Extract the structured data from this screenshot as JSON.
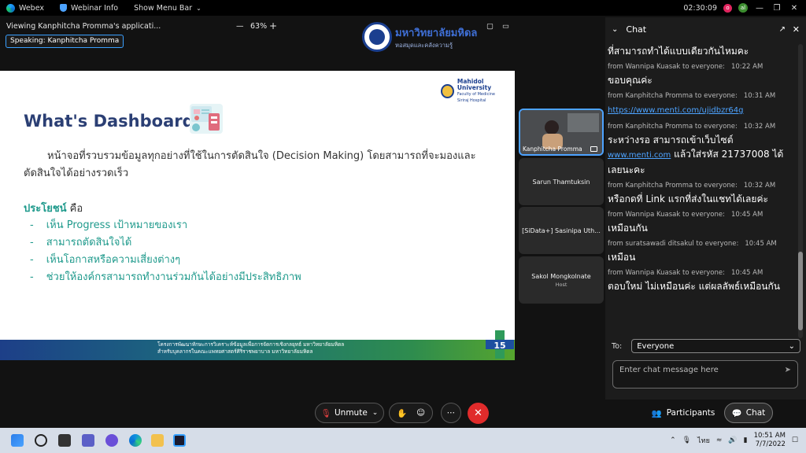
{
  "titlebar": {
    "app": "Webex",
    "webinar_info": "Webinar Info",
    "show_menu": "Show Menu Bar",
    "timer": "02:30:09",
    "badge_o": "o",
    "badge_g": "al"
  },
  "viewbar": {
    "viewing": "Viewing Kanphitcha Promma's applicati...",
    "zoom": "63%",
    "speaking": "Speaking: Kanphitcha Promma"
  },
  "header_logo": {
    "name": "มหาวิทยาลัยมหิดล",
    "sub": "หอสมุดและคลังความรู้"
  },
  "slide": {
    "logo_name": "Mahidol University",
    "logo_sub1": "Faculty of Medicine",
    "logo_sub2": "Siriraj Hospital",
    "title": "What's Dashboard?",
    "body": "หน้าจอที่รวบรวมข้อมูลทุกอย่างที่ใช้ในการตัดสินใจ (Decision Making) โดยสามารถที่จะมองและตัดสินใจได้อย่างรวดเร็ว",
    "benefit_label": "ประโยชน์",
    "benefit_rest": " คือ",
    "bullets": [
      "เห็น Progress เป้าหมายของเรา",
      "สามารถตัดสินใจได้",
      "เห็นโอกาสหรือความเสี่ยงต่างๆ",
      "ช่วยให้องค์กรสามารถทำงานร่วมกันได้อย่างมีประสิทธิภาพ"
    ],
    "footer_line1": "โครงการพัฒนาทักษะการวิเคราะห์ข้อมูลเพื่อการจัดการเชิงกลยุทธ์ มหาวิทยาลัยมหิดล",
    "footer_line2": "สำหรับบุคลากรในคณะแพทยศาสตร์ศิริราชพยาบาล มหาวิทยาลัยมหิดล",
    "page_number": "15"
  },
  "participants": [
    {
      "name": "Kanphitcha Promma",
      "video": true
    },
    {
      "name": "Sarun Thamtuksin"
    },
    {
      "name": "[SiData+] Sasinipa Uth..."
    },
    {
      "name": "Sakol Mongkolnate",
      "role": "Host"
    }
  ],
  "chat": {
    "title": "Chat",
    "messages": [
      {
        "meta": "",
        "time": "",
        "text": "ที่สามารถทำได้แบบเดียวกันไหมคะ"
      },
      {
        "meta": "from Wannipa Kuasak to everyone:",
        "time": "10:22 AM",
        "text": "ขอบคุณค่ะ"
      },
      {
        "meta": "from Kanphitcha Promma to everyone:",
        "time": "10:31 AM",
        "link": "https://www.menti.com/ujidbzr64g"
      },
      {
        "meta": "from Kanphitcha Promma to everyone:",
        "time": "10:32 AM",
        "text": "ระหว่างรอ สามารถเข้าเว็บไซต์",
        "link2": "www.menti.com",
        "text2": " แล้วใส่รหัส 21737008 ได้เลยนะคะ"
      },
      {
        "meta": "from Kanphitcha Promma to everyone:",
        "time": "10:32 AM",
        "text": "หรือกดที่ Link แรกที่ส่งในแชทได้เลยค่ะ"
      },
      {
        "meta": "from Wannipa Kuasak to everyone:",
        "time": "10:45 AM",
        "text": "เหมือนกัน"
      },
      {
        "meta": "from suratsawadi ditsakul to everyone:",
        "time": "10:45 AM",
        "text": "เหมือน"
      },
      {
        "meta": "from Wannipa Kuasak to everyone:",
        "time": "10:45 AM",
        "text": "ตอบใหม่ ไม่เหมือนค่ะ แต่ผลลัพธ์เหมือนกัน"
      }
    ],
    "to_label": "To:",
    "to_value": "Everyone",
    "input_placeholder": "Enter chat message here"
  },
  "controls": {
    "unmute": "Unmute",
    "participants": "Participants",
    "chat": "Chat"
  },
  "taskbar": {
    "lang": "ไทย",
    "time": "10:51 AM",
    "date": "7/7/2022"
  }
}
